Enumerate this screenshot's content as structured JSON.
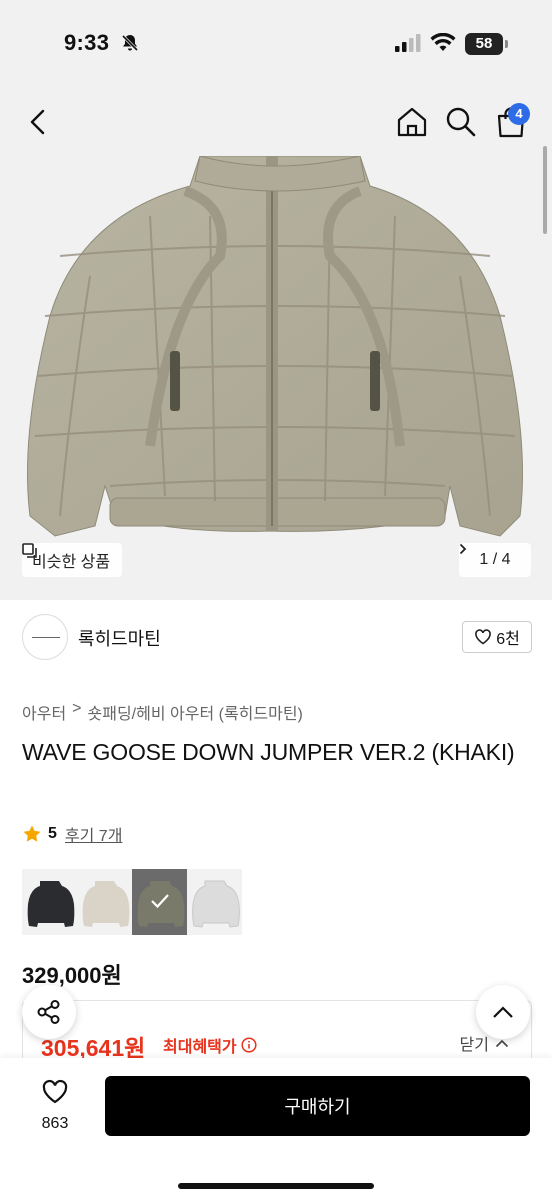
{
  "status": {
    "time": "9:33",
    "battery": "58"
  },
  "nav": {
    "cart_count": "4"
  },
  "gallery": {
    "similar_label": "비슷한 상품",
    "pager": "1 / 4"
  },
  "brand": {
    "name": "록히드마틴",
    "likes": "6천"
  },
  "breadcrumb": {
    "level1": "아우터",
    "separator": ">",
    "level2": "숏패딩/헤비 아우터 (록히드마틴)"
  },
  "product": {
    "title": "WAVE GOOSE DOWN JUMPER VER.2 (KHAKI)",
    "rating": "5",
    "reviews": "후기 7개",
    "price": "329,000원",
    "colors": [
      {
        "name": "black",
        "color": "#2a2c2f"
      },
      {
        "name": "ivory",
        "color": "#d9d4c7"
      },
      {
        "name": "khaki",
        "color": "#7a7a6a",
        "selected": true
      },
      {
        "name": "light-gray",
        "color": "#dcdcdc"
      }
    ]
  },
  "benefit": {
    "sale_price": "305,641원",
    "sale_label": "최대혜택가",
    "close_label": "닫기"
  },
  "bottom": {
    "wish_count": "863",
    "buy_label": "구매하기"
  },
  "colors": {
    "accent_blue": "#2d6ce6",
    "sale_red": "#e8331d"
  }
}
